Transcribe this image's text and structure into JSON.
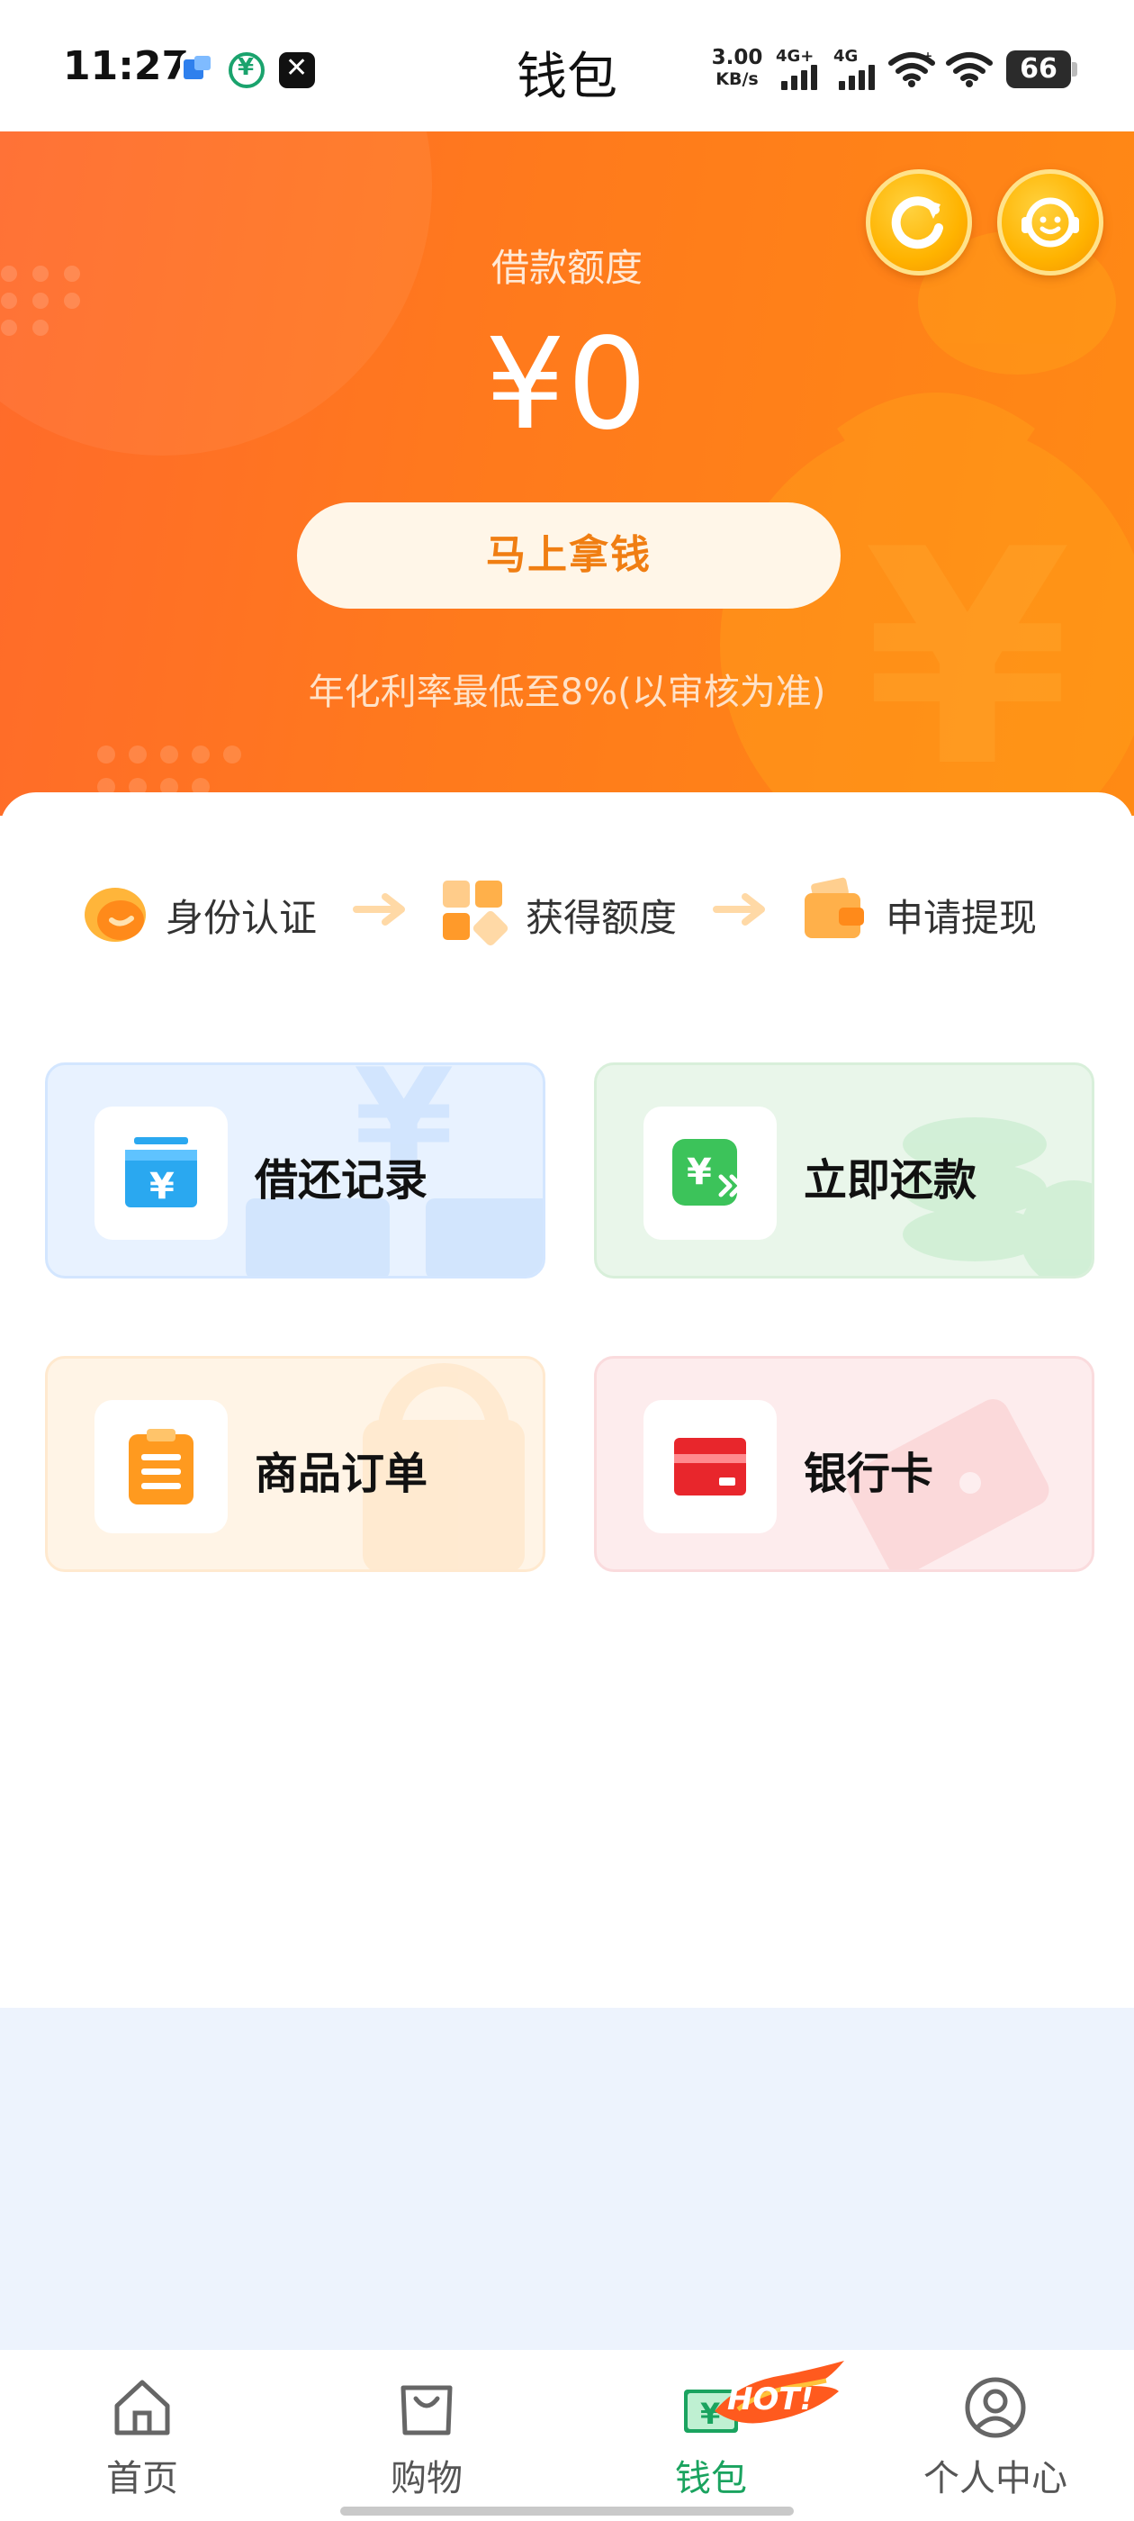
{
  "status_bar": {
    "time": "11:27",
    "net_speed_value": "3.00",
    "net_speed_unit": "KB/s",
    "sim1": "4G+",
    "sim2": "4G",
    "battery": "66",
    "app_icons": [
      "message-app-icon",
      "currency-app-icon",
      "capcut-app-icon"
    ]
  },
  "header": {
    "title": "钱包"
  },
  "hero": {
    "quota_label": "借款额度",
    "quota_value": "¥0",
    "cta_label": "马上拿钱",
    "rate_note": "年化利率最低至8%(以审核为准)",
    "icons": [
      "refresh-icon",
      "customer-service-icon"
    ],
    "colors": {
      "gradient_start": "#ff6a2b",
      "gradient_end": "#ff8a14",
      "cta_text": "#f07e12"
    }
  },
  "steps": [
    {
      "label": "身份认证",
      "icon": "identity-icon"
    },
    {
      "label": "获得额度",
      "icon": "quota-icon"
    },
    {
      "label": "申请提现",
      "icon": "wallet-icon"
    }
  ],
  "tiles": [
    {
      "label": "借还记录",
      "icon": "loan-record-icon",
      "color": "#2aa8f0"
    },
    {
      "label": "立即还款",
      "icon": "repay-icon",
      "color": "#3cc35a"
    },
    {
      "label": "商品订单",
      "icon": "clipboard-icon",
      "color": "#ff9a1f"
    },
    {
      "label": "银行卡",
      "icon": "bank-card-icon",
      "color": "#e8262c"
    }
  ],
  "tabbar": {
    "items": [
      {
        "label": "首页",
        "icon": "home-icon",
        "active": false
      },
      {
        "label": "购物",
        "icon": "shopping-bag-icon",
        "active": false
      },
      {
        "label": "钱包",
        "icon": "wallet-tab-icon",
        "active": true
      },
      {
        "label": "个人中心",
        "icon": "user-icon",
        "active": false
      }
    ],
    "badge": "HOT!",
    "active_color": "#1aa35f"
  }
}
